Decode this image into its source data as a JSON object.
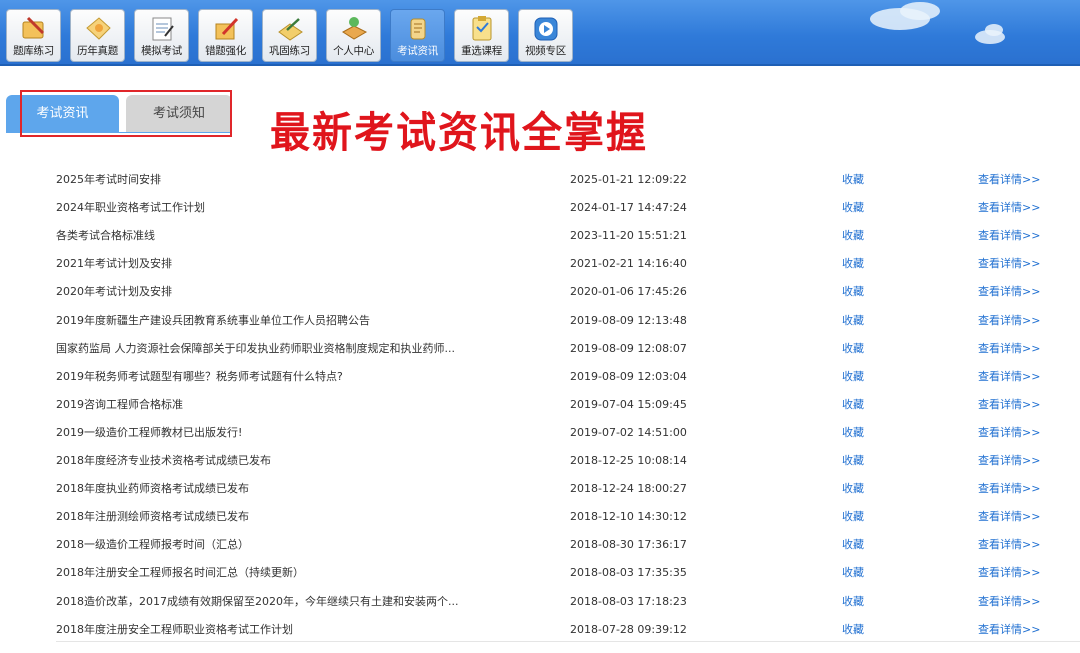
{
  "nav": {
    "items": [
      {
        "label": "题库练习",
        "icon": "book-pencil-icon"
      },
      {
        "label": "历年真题",
        "icon": "pencil-note-icon"
      },
      {
        "label": "模拟考试",
        "icon": "test-paper-icon"
      },
      {
        "label": "错题强化",
        "icon": "pen-edit-icon"
      },
      {
        "label": "巩固练习",
        "icon": "notebook-icon"
      },
      {
        "label": "个人中心",
        "icon": "person-book-icon"
      },
      {
        "label": "考试资讯",
        "icon": "news-scroll-icon",
        "active": true
      },
      {
        "label": "重选课程",
        "icon": "clipboard-icon"
      },
      {
        "label": "视频专区",
        "icon": "video-play-icon"
      }
    ]
  },
  "tabs": {
    "active_label": "考试资讯",
    "inactive_label": "考试须知"
  },
  "headline": "最新考试资讯全掌握",
  "list": {
    "fav_label": "收藏",
    "detail_label": "查看详情>>",
    "rows": [
      {
        "title": "2025年考试时间安排",
        "date": "2025-01-21 12:09:22"
      },
      {
        "title": "2024年职业资格考试工作计划",
        "date": "2024-01-17 14:47:24"
      },
      {
        "title": "各类考试合格标准线",
        "date": "2023-11-20 15:51:21"
      },
      {
        "title": "2021年考试计划及安排",
        "date": "2021-02-21 14:16:40"
      },
      {
        "title": "2020年考试计划及安排",
        "date": "2020-01-06 17:45:26"
      },
      {
        "title": "2019年度新疆生产建设兵团教育系统事业单位工作人员招聘公告",
        "date": "2019-08-09 12:13:48"
      },
      {
        "title": "国家药监局 人力资源社会保障部关于印发执业药师职业资格制度规定和执业药师...",
        "date": "2019-08-09 12:08:07"
      },
      {
        "title": "2019年税务师考试题型有哪些？税务师考试题有什么特点?",
        "date": "2019-08-09 12:03:04"
      },
      {
        "title": "2019咨询工程师合格标准",
        "date": "2019-07-04 15:09:45"
      },
      {
        "title": "2019一级造价工程师教材已出版发行!",
        "date": "2019-07-02 14:51:00"
      },
      {
        "title": "2018年度经济专业技术资格考试成绩已发布",
        "date": "2018-12-25 10:08:14"
      },
      {
        "title": "2018年度执业药师资格考试成绩已发布",
        "date": "2018-12-24 18:00:27"
      },
      {
        "title": "2018年注册测绘师资格考试成绩已发布",
        "date": "2018-12-10 14:30:12"
      },
      {
        "title": "2018一级造价工程师报考时间（汇总）",
        "date": "2018-08-30 17:36:17"
      },
      {
        "title": "2018年注册安全工程师报名时间汇总（持续更新）",
        "date": "2018-08-03 17:35:35"
      },
      {
        "title": "2018造价改革，2017成绩有效期保留至2020年，今年继续只有土建和安装两个...",
        "date": "2018-08-03 17:18:23"
      },
      {
        "title": "2018年度注册安全工程师职业资格考试工作计划",
        "date": "2018-07-28 09:39:12"
      }
    ]
  },
  "colors": {
    "topbar": "#2f7ad9",
    "tab_active": "#5ea6ec",
    "headline": "#e0151c",
    "link": "#1f6fd1",
    "highlight_box": "#e0262a"
  }
}
